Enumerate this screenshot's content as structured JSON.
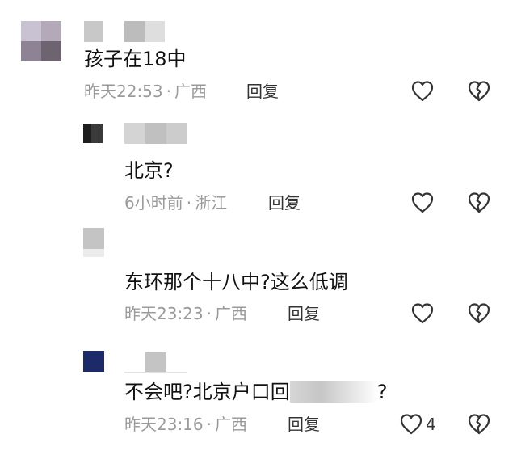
{
  "comments": [
    {
      "text": "孩子在18中",
      "time": "昨天22:53",
      "location": "广西",
      "reply_label": "回复"
    },
    {
      "text": "北京?",
      "time": "6小时前",
      "location": "浙江",
      "reply_label": "回复"
    },
    {
      "text": "东环那个十八中?这么低调",
      "time": "昨天23:23",
      "location": "广西",
      "reply_label": "回复"
    },
    {
      "text_before": "不会吧?北京户口回",
      "text_after": "?",
      "time": "昨天23:16",
      "location": "广西",
      "reply_label": "回复",
      "like_count": "4"
    }
  ],
  "separator": "·",
  "icons": {
    "like": "heart-outline-icon",
    "dislike": "broken-heart-icon"
  }
}
